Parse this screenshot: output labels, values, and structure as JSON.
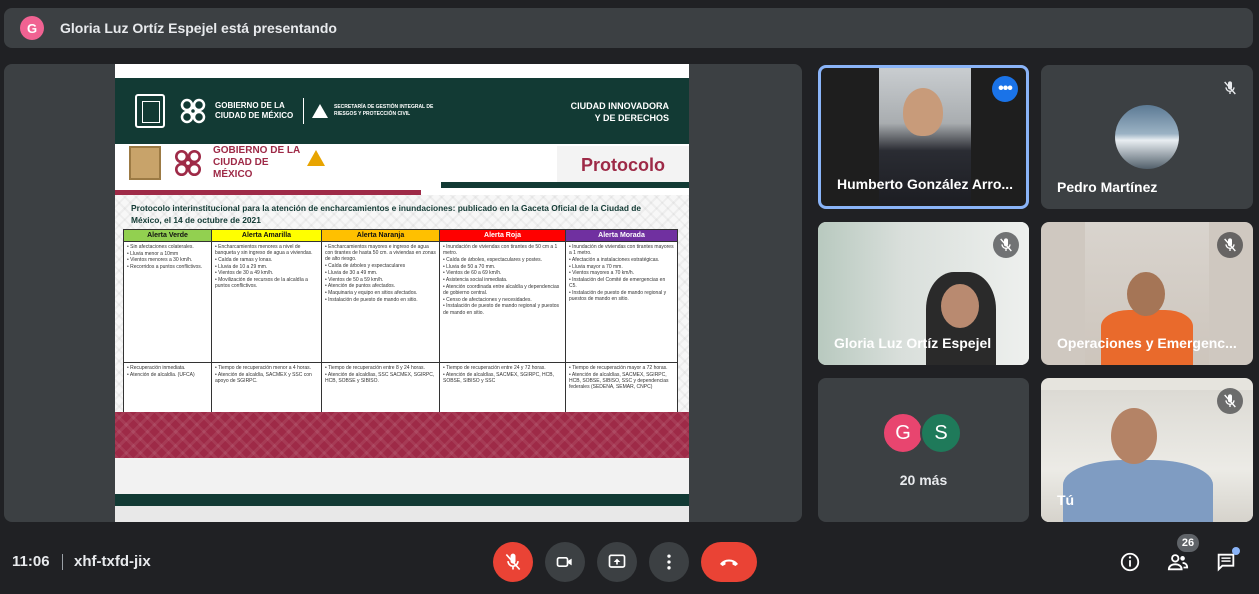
{
  "presenting_bar": {
    "avatar_letter": "G",
    "avatar_color": "#f06292",
    "title": "Gloria Luz Ortíz Espejel está presentando"
  },
  "slide": {
    "banner": {
      "gov_text": "GOBIERNO DE LA CIUDAD DE MÉXICO",
      "secretaria": "SECRETARÍA DE GESTIÓN INTEGRAL DE RIESGOS Y PROTECCIÓN CIVIL",
      "slogan_line1": "CIUDAD INNOVADORA",
      "slogan_line2": "Y DE DERECHOS"
    },
    "gov_text_2": "GOBIERNO DE LA CIUDAD DE MÉXICO",
    "section_label": "Protocolo",
    "title": "Protocolo interinstitucional para la atención de encharcamientos e inundaciones: publicado en la Gaceta Oficial de la Ciudad de México, el 14 de octubre de 2021",
    "table": {
      "headers": [
        {
          "label": "Alerta Verde",
          "color": "#92d050"
        },
        {
          "label": "Alerta Amarilla",
          "color": "#ffff00"
        },
        {
          "label": "Alerta Naranja",
          "color": "#ffc000"
        },
        {
          "label": "Alerta Roja",
          "color": "#ff0000"
        },
        {
          "label": "Alerta Morada",
          "color": "#7030a0"
        }
      ],
      "row1": [
        [
          "Sin afectaciones colaterales.",
          "Lluvia menor a 10mm",
          "Vientos menores a 30 km/h.",
          "Recorridos a puntos conflictivos."
        ],
        [
          "Encharcamientos menores a nivel de banqueta y sin ingreso de agua a viviendas.",
          "Caída de ramas y lonas.",
          "Lluvia de 10 a 29 mm.",
          "Vientos de 30 a 49 km/h.",
          "Movilización de recursos de la alcaldía a puntos conflictivos."
        ],
        [
          "Encharcamientos mayores e ingreso de agua con tirantes de hasta 50 cm. a viviendas en zonas de alto riesgo.",
          "Caída de árboles y espectaculares",
          "Lluvia de 30 a 49 mm.",
          "Vientos de 50 a 59 km/h.",
          "Atención de puntos afectados.",
          "Maquinaria y equipo en sitios afectados.",
          "Instalación de puesto de mando en sitio."
        ],
        [
          "Inundación de viviendas con tirantes de 50 cm a 1 metro.",
          "Caída de árboles, espectaculares y postes.",
          "Lluvia de 50 a 70 mm.",
          "Vientos de 60 a 69 km/h.",
          "Asistencia social inmediata.",
          "Atención coordinada entre alcaldía y dependencias de gobierno central.",
          "Censo de afectaciones y necesidades.",
          "Instalación de puesto de mando regional y puestos de mando en sitio."
        ],
        [
          "Inundación de viviendas con tirantes mayores a 1 metro.",
          "Afectación a instalaciones estratégicas.",
          "Lluvia mayor a 70 mm.",
          "Vientos mayores a 70 km/h.",
          "Instalación del Comité de emergencias en C5.",
          "Instalación de puesto de mando regional y puestos de mando en sitio."
        ]
      ],
      "row2": [
        [
          "Recuperación inmediata.",
          "Atención de alcaldía. (UFCA)"
        ],
        [
          "Tiempo de recuperación menor a 4 horas.",
          "Atención de alcaldía, SACMEX y SSC con apoyo de SGIRPC."
        ],
        [
          "Tiempo de recuperación entre 8 y 24 horas.",
          "Atención de alcaldías, SSC SACMEX, SGIRPC, HCB, SOBSE y SIBISO."
        ],
        [
          "Tiempo de recuperación entre 24 y 72 horas.",
          "Atención de alcaldías, SACMEX, SGIRPC, HCB, SOBSE, SIBISO y SSC"
        ],
        [
          "Tiempo de recuperación mayor a 72 horas.",
          "Atención de alcaldías, SACMEX, SGIRPC, HCB, SOBSE, SIBISO, SSC y dependencias federales (SEDENA, SEMAR, CNPC)"
        ]
      ]
    }
  },
  "participants": {
    "humberto": "Humberto González Arro...",
    "pedro": "Pedro Martínez",
    "gloria": "Gloria Luz Ortíz Espejel",
    "operaciones": "Operaciones y Emergenc...",
    "more_tile": {
      "avatar1": "G",
      "avatar2": "S",
      "label": "20 más"
    },
    "self": "Tú"
  },
  "bottom_bar": {
    "time": "11:06",
    "meeting_code": "xhf-txfd-jix",
    "people_count": "26",
    "icons": [
      "mic-off-icon",
      "camera-icon",
      "present-screen-icon",
      "more-options-icon",
      "hang-up-icon",
      "info-icon",
      "people-icon",
      "chat-icon"
    ]
  }
}
